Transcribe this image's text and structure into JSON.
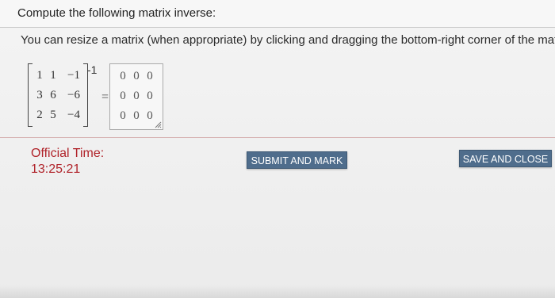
{
  "page": {
    "title": "Compute the following matrix inverse:",
    "instruction": "You can resize a matrix (when appropriate) by clicking and dragging the bottom-right corner of the matrix."
  },
  "question": {
    "matrix": [
      [
        "1",
        "1",
        "−1"
      ],
      [
        "3",
        "6",
        "−6"
      ],
      [
        "2",
        "5",
        "−4"
      ]
    ],
    "exponent": "-1",
    "equals": "="
  },
  "answer": {
    "matrix": [
      [
        "0",
        "0",
        "0"
      ],
      [
        "0",
        "0",
        "0"
      ],
      [
        "0",
        "0",
        "0"
      ]
    ]
  },
  "timer": {
    "label": "Official Time:",
    "value": "13:25:21",
    "color": "#b0232a"
  },
  "buttons": {
    "submit_label": "SUBMIT AND MARK",
    "save_label": "SAVE AND CLOSE",
    "color": "#4f6d8c"
  },
  "icons": {
    "resize": "resize-corner-icon"
  }
}
